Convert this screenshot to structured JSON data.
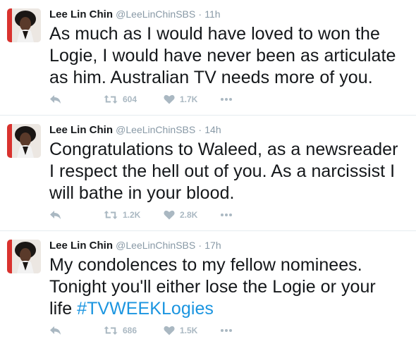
{
  "colors": {
    "text": "#14171a",
    "muted": "#8899a6",
    "icon": "#aab8c2",
    "hashtag": "#1b95e0",
    "divider": "#e6ecf0"
  },
  "tweets": [
    {
      "name": "Lee Lin Chin",
      "handle": "@LeeLinChinSBS",
      "separator": "·",
      "time": "11h",
      "text": "As much as I would have loved to won the\nLogie, I would have never been as articulate\nas him. Australian TV needs more of you.",
      "hashtag": "",
      "retweets": "604",
      "likes": "1.7K"
    },
    {
      "name": "Lee Lin Chin",
      "handle": "@LeeLinChinSBS",
      "separator": "·",
      "time": "14h",
      "text": "Congratulations to Waleed, as a newsreader\nI respect the hell out of you. As a narcissist I\nwill bathe in your blood.",
      "hashtag": "",
      "retweets": "1.2K",
      "likes": "2.8K"
    },
    {
      "name": "Lee Lin Chin",
      "handle": "@LeeLinChinSBS",
      "separator": "·",
      "time": "17h",
      "text": "My condolences to my fellow nominees.\nTonight you'll either lose the Logie or your\nlife ",
      "hashtag": "#TVWEEKLogies",
      "retweets": "686",
      "likes": "1.5K"
    }
  ],
  "icons": {
    "reply": "reply-icon",
    "retweet": "retweet-icon",
    "like": "heart-icon",
    "more": "more-icon"
  }
}
